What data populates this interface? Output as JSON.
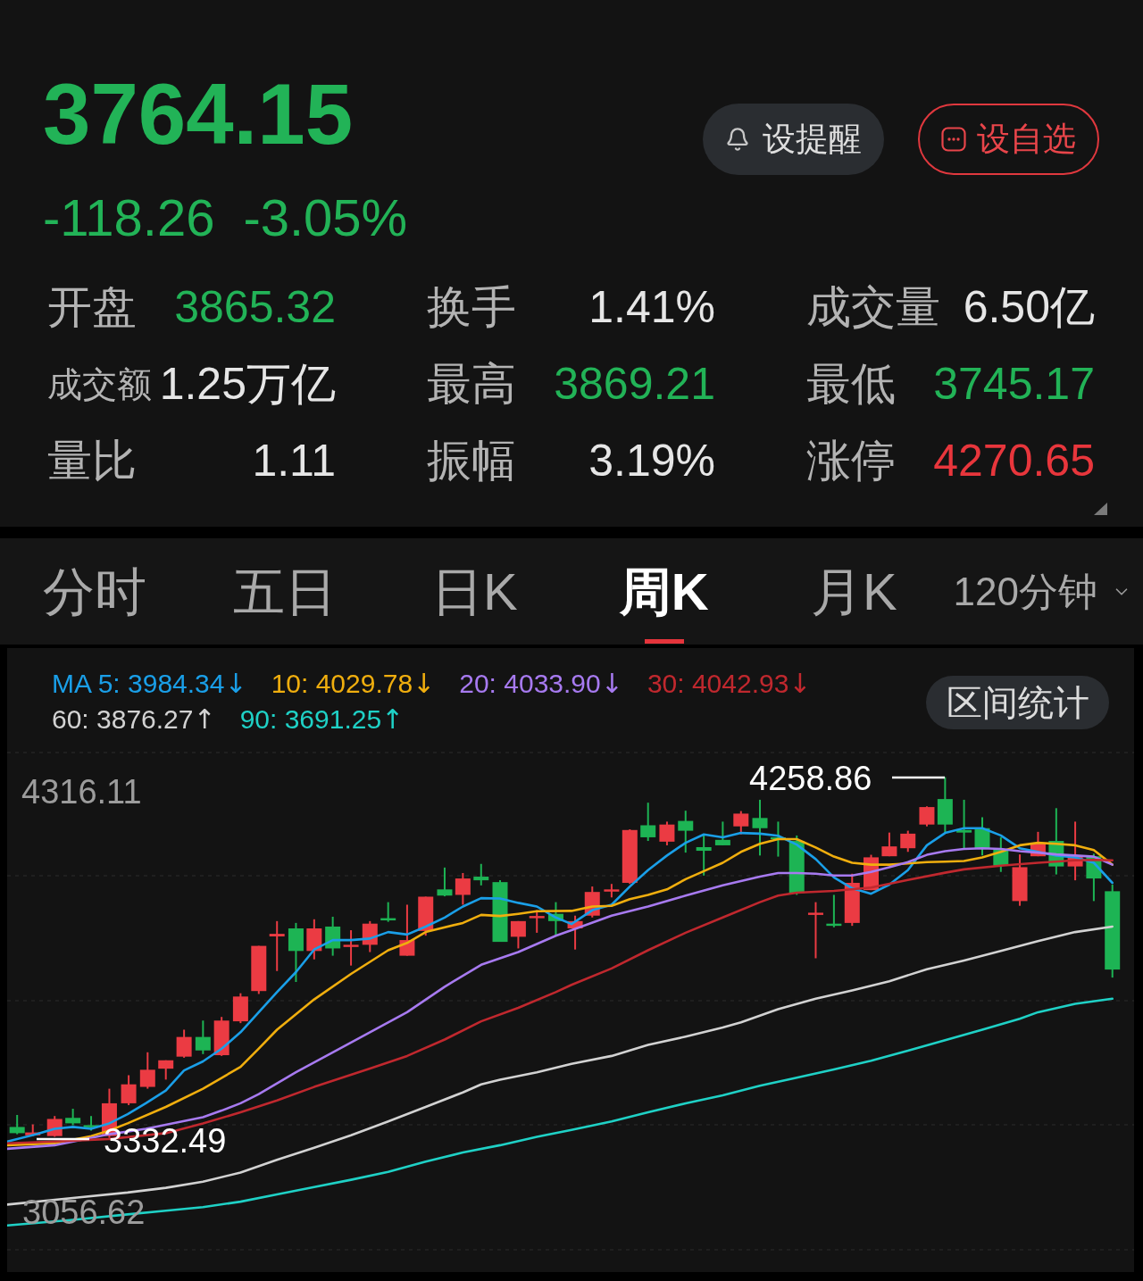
{
  "quote": {
    "price": "3764.15",
    "change": "-118.26",
    "change_percent": "-3.05%",
    "falling": true
  },
  "actions": [
    {
      "label": "设提醒",
      "kind": "alert"
    },
    {
      "label": "设自选",
      "kind": "watchlist"
    }
  ],
  "stats": [
    {
      "label": "开盘",
      "value": "3865.32",
      "color": "#22b357"
    },
    {
      "label": "换手",
      "value": "1.41%",
      "color": "#e6e6e6"
    },
    {
      "label": "成交量",
      "value": "6.50亿",
      "color": "#e6e6e6"
    },
    {
      "label": "成交额",
      "value": "1.25万亿",
      "color": "#e6e6e6"
    },
    {
      "label": "最高",
      "value": "3869.21",
      "color": "#22b357"
    },
    {
      "label": "最低",
      "value": "3745.17",
      "color": "#22b357"
    },
    {
      "label": "量比",
      "value": "1.11",
      "color": "#e6e6e6"
    },
    {
      "label": "振幅",
      "value": "3.19%",
      "color": "#e6e6e6"
    },
    {
      "label": "涨停",
      "value": "4270.65",
      "color": "#e8363c"
    }
  ],
  "tabs": [
    {
      "label": "分时",
      "selected": false,
      "kind": "period"
    },
    {
      "label": "五日",
      "selected": false,
      "kind": "period"
    },
    {
      "label": "日K",
      "selected": false,
      "kind": "period"
    },
    {
      "label": "周K",
      "selected": true,
      "kind": "period"
    },
    {
      "label": "月K",
      "selected": false,
      "kind": "period"
    },
    {
      "label": "120分钟",
      "selected": false,
      "kind": "dropdown"
    }
  ],
  "ma_legend": [
    {
      "text": "MA 5: 3984.34",
      "arrow": "↓",
      "color": "#1a9fe8"
    },
    {
      "text": "10: 4029.78",
      "arrow": "↓",
      "color": "#f0ae0e"
    },
    {
      "text": "20: 4033.90",
      "arrow": "↓",
      "color": "#a77af0"
    },
    {
      "text": "30: 4042.93",
      "arrow": "↓",
      "color": "#c0282e"
    },
    {
      "text": "60: 3876.27",
      "arrow": "↑",
      "color": "#d2d2d2"
    },
    {
      "text": "90: 3691.25",
      "arrow": "↑",
      "color": "#1fd1c6"
    }
  ],
  "range_stats_button": {
    "label": "区间统计"
  },
  "chart": {
    "axis_top_label": "4316.11",
    "axis_bottom_label": "3056.62",
    "high_label": "4258.86",
    "low_label": "3332.49"
  }
}
